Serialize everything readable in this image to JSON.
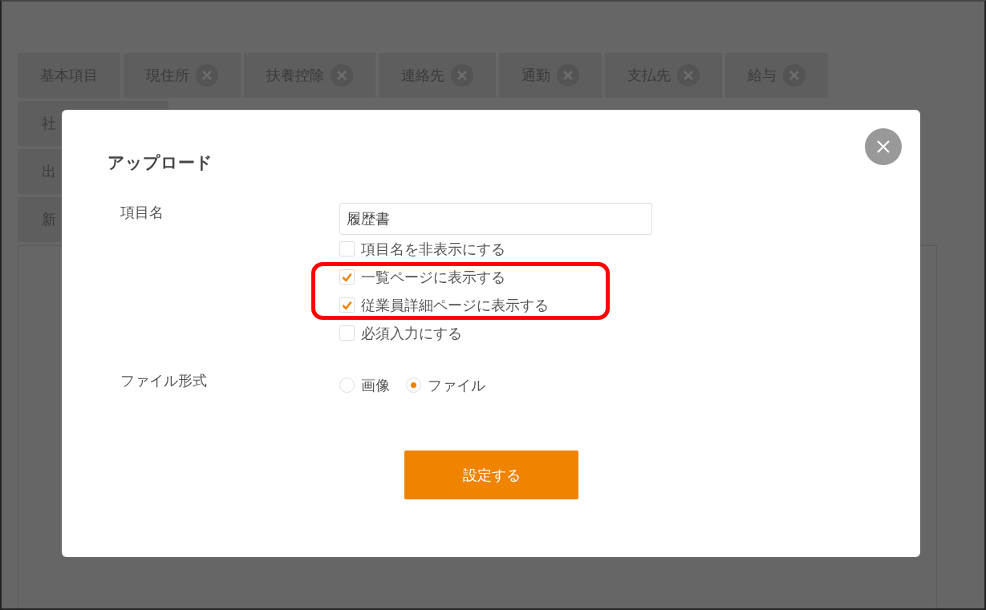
{
  "background_tabs": [
    {
      "label": "基本項目",
      "removable": false
    },
    {
      "label": "現住所",
      "removable": true
    },
    {
      "label": "扶養控除",
      "removable": true
    },
    {
      "label": "連絡先",
      "removable": true
    },
    {
      "label": "通勤",
      "removable": true
    },
    {
      "label": "支払先",
      "removable": true
    },
    {
      "label": "給与",
      "removable": true
    }
  ],
  "background_rows": [
    "社",
    "出",
    "新"
  ],
  "dialog": {
    "title": "アップロード",
    "item_name": {
      "label": "項目名",
      "value": "履歴書",
      "options": [
        {
          "label": "項目名を非表示にする",
          "checked": false,
          "highlighted": false
        },
        {
          "label": "一覧ページに表示する",
          "checked": true,
          "highlighted": true
        },
        {
          "label": "従業員詳細ページに表示する",
          "checked": true,
          "highlighted": true
        },
        {
          "label": "必須入力にする",
          "checked": false,
          "highlighted": false
        }
      ]
    },
    "file_format": {
      "label": "ファイル形式",
      "choices": [
        {
          "label": "画像",
          "selected": false
        },
        {
          "label": "ファイル",
          "selected": true
        }
      ]
    },
    "submit": "設定する"
  }
}
